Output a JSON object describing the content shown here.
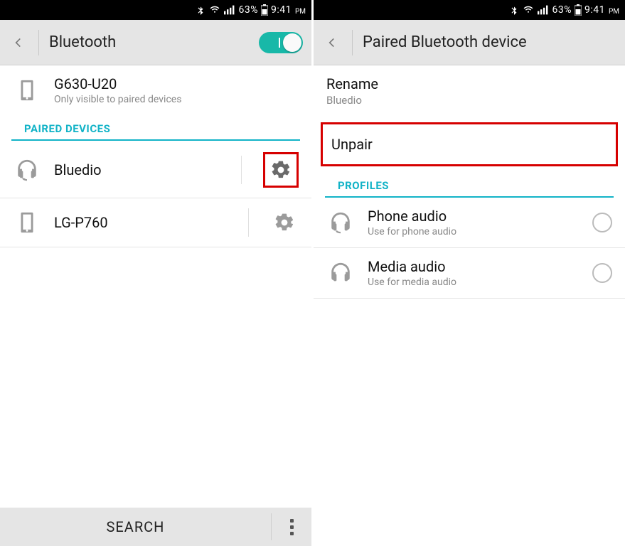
{
  "statusbar": {
    "battery_pct": "63%",
    "time": "9:41",
    "ampm": "PM"
  },
  "left": {
    "title": "Bluetooth",
    "own_device": {
      "name": "G630-U20",
      "subtitle": "Only visible to paired devices"
    },
    "section_paired": "PAIRED DEVICES",
    "paired": [
      {
        "name": "Bluedio",
        "icon": "headphones"
      },
      {
        "name": "LG-P760",
        "icon": "phone"
      }
    ],
    "bottom": {
      "search_label": "SEARCH"
    }
  },
  "right": {
    "title": "Paired Bluetooth device",
    "rename": {
      "label": "Rename",
      "value": "Bluedio"
    },
    "unpair_label": "Unpair",
    "section_profiles": "PROFILES",
    "profiles": [
      {
        "name": "Phone audio",
        "subtitle": "Use for phone audio",
        "icon": "headset"
      },
      {
        "name": "Media audio",
        "subtitle": "Use for media audio",
        "icon": "headphones"
      }
    ]
  }
}
